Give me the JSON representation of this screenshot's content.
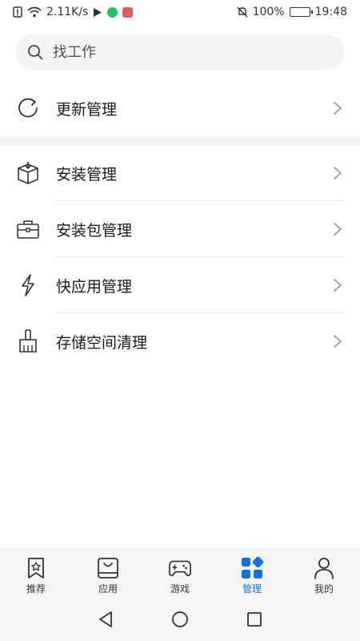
{
  "status_bar": {
    "net_speed": "2.11K/s",
    "battery": "100%",
    "time": "19:48"
  },
  "search": {
    "placeholder": "找工作"
  },
  "list": {
    "update": "更新管理",
    "install": "安装管理",
    "package": "安装包管理",
    "quick_app": "快应用管理",
    "storage": "存储空间清理"
  },
  "bottom_nav": {
    "items": [
      {
        "label": "推荐",
        "icon": "star-bookmark-icon"
      },
      {
        "label": "应用",
        "icon": "app-store-bag-icon"
      },
      {
        "label": "游戏",
        "icon": "gamepad-icon"
      },
      {
        "label": "管理",
        "icon": "manage-grid-icon"
      },
      {
        "label": "我的",
        "icon": "person-icon"
      }
    ],
    "active_index": 3
  },
  "colors": {
    "accent": "#1a6fe0",
    "icon_gray": "#333333"
  }
}
